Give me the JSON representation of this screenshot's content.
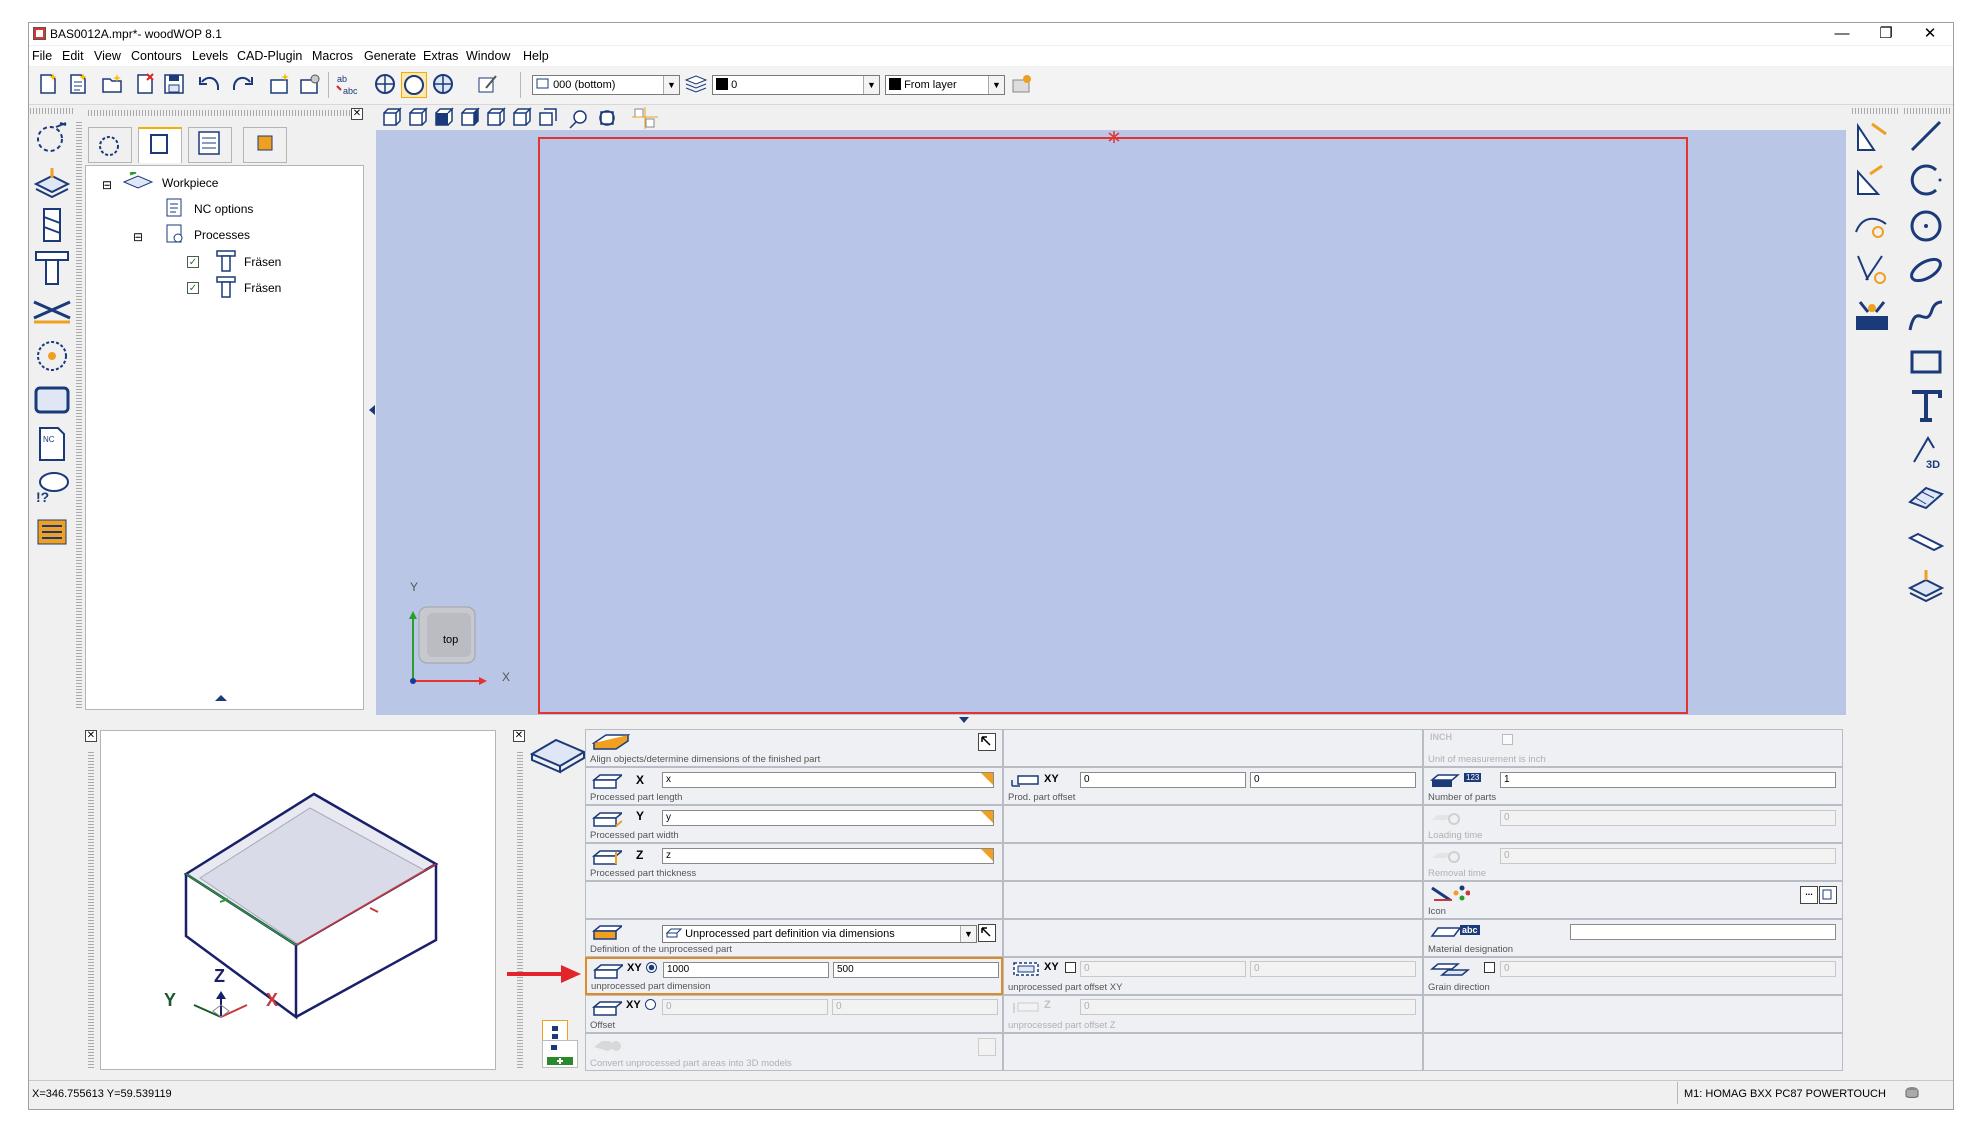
{
  "window": {
    "title": "BAS0012A.mpr*- woodWOP 8.1",
    "minimize": "—",
    "restore": "❐",
    "close": "✕"
  },
  "menu": [
    "File",
    "Edit",
    "View",
    "Contours",
    "Levels",
    "CAD-Plugin",
    "Macros",
    "Generate",
    "Extras",
    "Window",
    "Help"
  ],
  "toolbar": {
    "plane_combo": "000  (bottom)",
    "color_combo": "0",
    "layer_combo": "From layer"
  },
  "tree": {
    "root": "Workpiece",
    "nc_options": "NC options",
    "processes": "Processes",
    "items": [
      "Fräsen",
      "Fräsen"
    ]
  },
  "viewport": {
    "axis_y": "Y",
    "axis_x": "X",
    "cube_label": "top"
  },
  "preview": {
    "axis_z": "Z",
    "axis_y": "Y",
    "axis_x": "X"
  },
  "props": {
    "align_label": "Align objects/determine dimensions of the finished part",
    "x_axis": "X",
    "x_value": "x",
    "x_label": "Processed part length",
    "y_axis": "Y",
    "y_value": "y",
    "y_label": "Processed part width",
    "z_axis": "Z",
    "z_value": "z",
    "z_label": "Processed part thickness",
    "def_combo": "Unprocessed part definition via dimensions",
    "def_label": "Definition of the unprocessed part",
    "unproc_xy": "XY",
    "unproc_x": "1000",
    "unproc_y": "500",
    "unproc_label": "unprocessed part dimension",
    "offset_xy": "XY",
    "offset_label": "Offset",
    "offset_x": "0",
    "offset_y": "0",
    "convert_label": "Convert unprocessed part areas into 3D models",
    "prod_xy": "XY",
    "prod_x": "0",
    "prod_y": "0",
    "prod_label": "Prod. part offset",
    "uoff_xy": "XY",
    "uoff_x": "0",
    "uoff_y": "0",
    "uoff_label": "unprocessed part offset XY",
    "uoffz_axis": "Z",
    "uoffz_value": "0",
    "uoffz_label": "unprocessed part offset Z",
    "inch_icon": "INCH",
    "inch_label": "Unit of measurement is inch",
    "parts_badge": "123",
    "parts_value": "1",
    "parts_label": "Number of parts",
    "loading_value": "0",
    "loading_label": "Loading time",
    "removal_value": "0",
    "removal_label": "Removal time",
    "icon_label": "Icon",
    "icon_btn": "...",
    "material_badge": "abc",
    "material_label": "Material designation",
    "material_value": "",
    "grain_value": "0",
    "grain_label": "Grain direction"
  },
  "status": {
    "coords": "X=346.755613 Y=59.539119",
    "machine": "M1: HOMAG BXX PC87 POWERTOUCH"
  }
}
